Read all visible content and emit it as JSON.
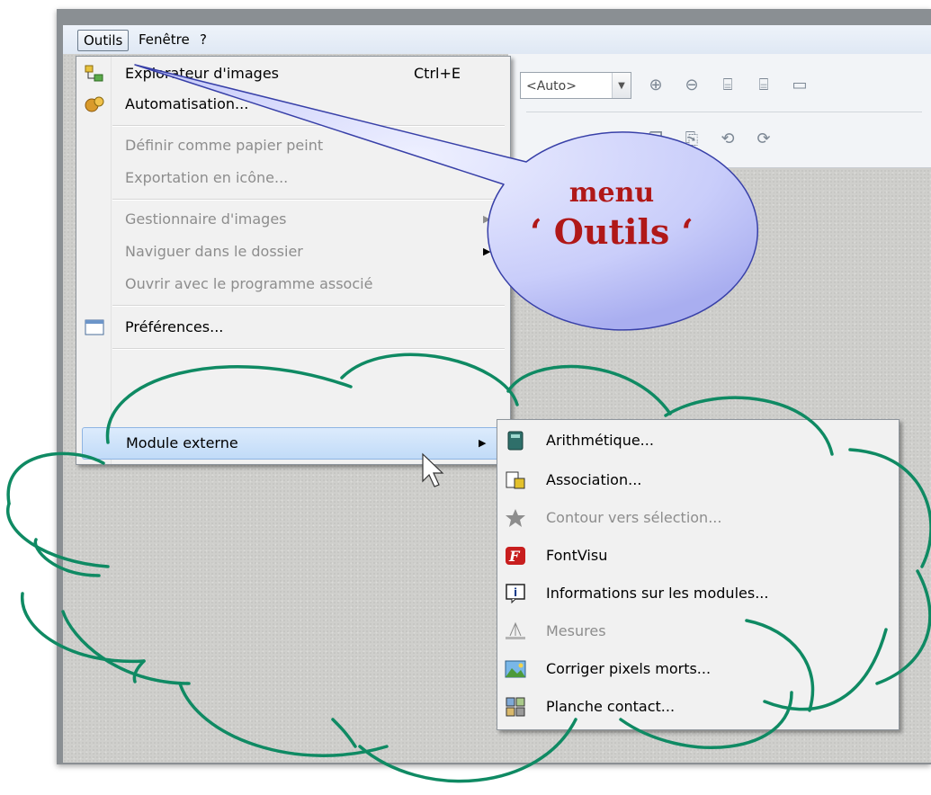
{
  "menubar": {
    "items": [
      {
        "label": "Outils"
      },
      {
        "label": "Fenêtre"
      },
      {
        "label": "?"
      }
    ]
  },
  "toolbar": {
    "zoom_value": "<Auto>"
  },
  "menu": {
    "items": [
      {
        "label": "Explorateur d'images",
        "accel": "Ctrl+E",
        "icon": "image-explorer-icon",
        "enabled": true
      },
      {
        "label": "Automatisation...",
        "icon": "automation-icon",
        "enabled": true
      },
      {
        "label": "Définir comme papier peint",
        "enabled": false
      },
      {
        "label": "Exportation en icône...",
        "enabled": false
      },
      {
        "label": "Gestionnaire d'images",
        "enabled": false,
        "submenu": true
      },
      {
        "label": "Naviguer dans le dossier",
        "enabled": false,
        "submenu": true
      },
      {
        "label": "Ouvrir avec le programme associé",
        "enabled": false
      },
      {
        "label": "Préférences...",
        "icon": "preferences-icon",
        "enabled": true
      },
      {
        "label": "Module externe",
        "enabled": true,
        "submenu": true,
        "highlighted": true
      }
    ]
  },
  "submenu": {
    "items": [
      {
        "label": "Arithmétique...",
        "icon": "calculator-icon",
        "enabled": true
      },
      {
        "label": "Association...",
        "icon": "association-icon",
        "enabled": true
      },
      {
        "label": "Contour vers sélection...",
        "icon": "star-icon",
        "enabled": false
      },
      {
        "label": "FontVisu",
        "icon": "font-icon",
        "enabled": true
      },
      {
        "label": "Informations sur les modules...",
        "icon": "info-icon",
        "enabled": true
      },
      {
        "label": "Mesures",
        "icon": "measure-icon",
        "enabled": false
      },
      {
        "label": "Corriger pixels morts...",
        "icon": "picture-fix-icon",
        "enabled": true
      },
      {
        "label": "Planche contact...",
        "icon": "contact-sheet-icon",
        "enabled": true
      }
    ]
  },
  "callout": {
    "line1": "menu",
    "line2": "‘ Outils ‘"
  },
  "colors": {
    "callout_fill": "#c9cdfa",
    "callout_text": "#b01818",
    "cloud_stroke": "#0f8a63",
    "highlight": "#c1dbf8"
  }
}
